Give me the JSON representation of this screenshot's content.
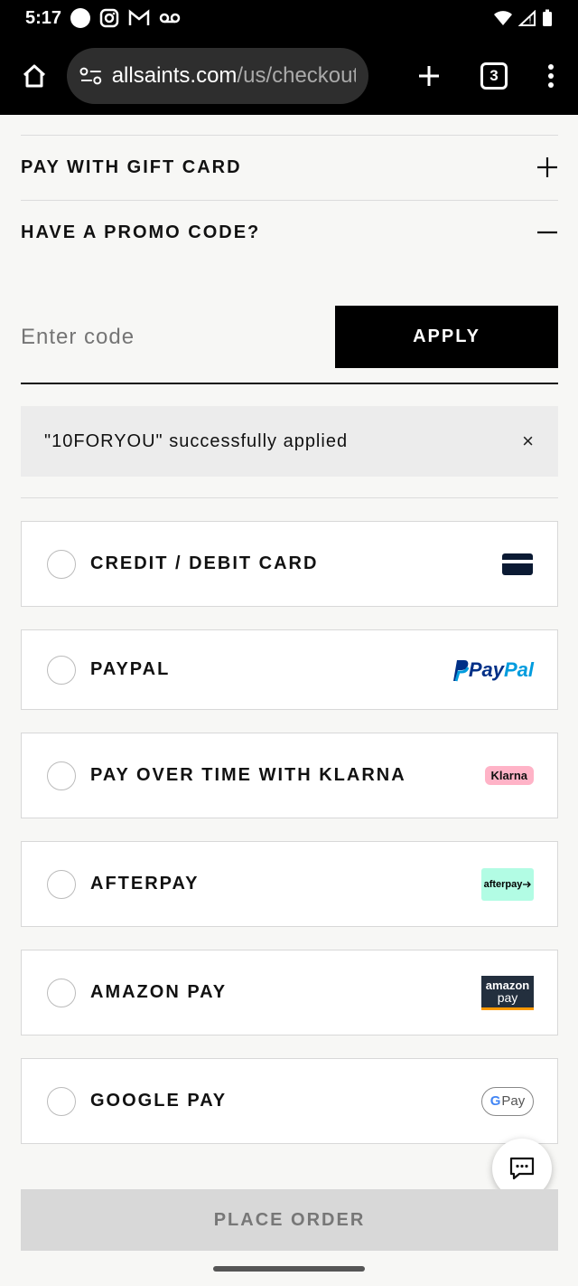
{
  "status_bar": {
    "time": "5:17"
  },
  "browser": {
    "url_domain": "allsaints.com",
    "url_path": "/us/checkout",
    "tab_count": "3"
  },
  "accordion": {
    "gift_card_title": "PAY WITH GIFT CARD",
    "promo_title": "HAVE A PROMO CODE?"
  },
  "promo": {
    "placeholder": "Enter code",
    "apply_label": "APPLY",
    "success_message": "\"10FORYOU\" successfully applied",
    "close_glyph": "×"
  },
  "payment_options": [
    {
      "label": "CREDIT / DEBIT CARD",
      "icon": "credit-card-icon"
    },
    {
      "label": "PAYPAL",
      "icon": "paypal-logo",
      "logo_text_1": "Pay",
      "logo_text_2": "Pal"
    },
    {
      "label": "PAY OVER TIME WITH KLARNA",
      "icon": "klarna-logo",
      "logo_text": "Klarna"
    },
    {
      "label": "AFTERPAY",
      "icon": "afterpay-logo",
      "logo_text": "afterpay"
    },
    {
      "label": "AMAZON PAY",
      "icon": "amazon-pay-logo",
      "logo_text_1": "amazon",
      "logo_text_2": "pay"
    },
    {
      "label": "GOOGLE PAY",
      "icon": "google-pay-logo",
      "logo_text_1": "G",
      "logo_text_2": "Pay"
    }
  ],
  "place_order_label": "PLACE ORDER",
  "colors": {
    "primary": "#000000",
    "background": "#f7f7f5",
    "disabled_button": "#d8d8d8",
    "klarna": "#ffb3c7",
    "afterpay": "#b2fce4",
    "amazon": "#232f3e",
    "paypal_dark": "#003087",
    "paypal_light": "#009cde"
  }
}
